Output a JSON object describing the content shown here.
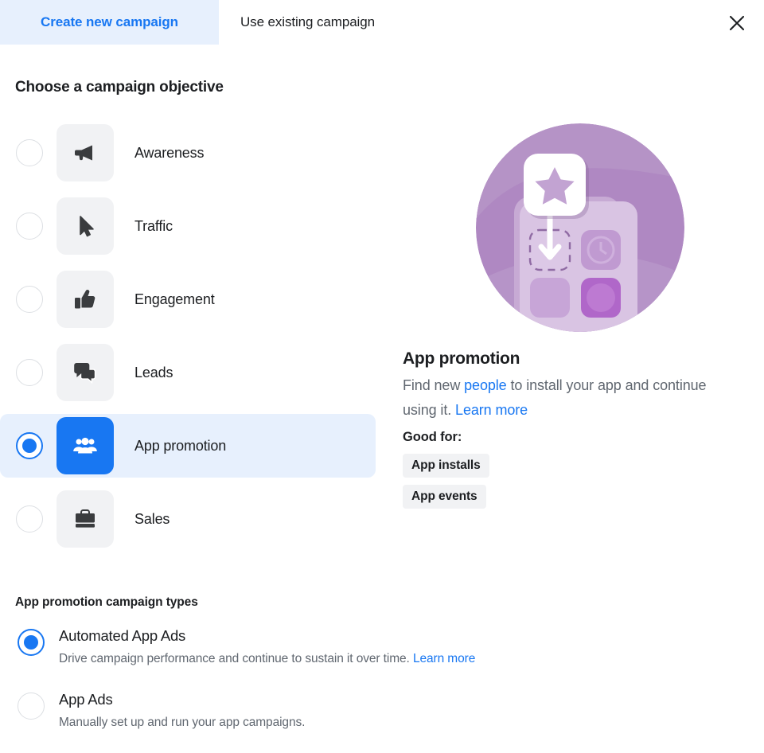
{
  "tabs": [
    {
      "label": "Create new campaign",
      "active": true
    },
    {
      "label": "Use existing campaign",
      "active": false
    }
  ],
  "close_icon": "close-icon",
  "headings": {
    "objective": "Choose a campaign objective",
    "campaign_types": "App promotion campaign types"
  },
  "objectives": [
    {
      "label": "Awareness",
      "icon": "megaphone-icon",
      "selected": false
    },
    {
      "label": "Traffic",
      "icon": "cursor-icon",
      "selected": false
    },
    {
      "label": "Engagement",
      "icon": "thumbs-up-icon",
      "selected": false
    },
    {
      "label": "Leads",
      "icon": "chat-bubbles-icon",
      "selected": false
    },
    {
      "label": "App promotion",
      "icon": "people-group-icon",
      "selected": true
    },
    {
      "label": "Sales",
      "icon": "briefcase-icon",
      "selected": false
    }
  ],
  "detail": {
    "illustration": "app-promotion-illustration",
    "title": "App promotion",
    "desc_part1": "Find new ",
    "desc_link1": "people",
    "desc_part2": " to install your app and continue using it. ",
    "desc_link2": "Learn more",
    "good_for_label": "Good for:",
    "tags": [
      "App installs",
      "App events"
    ]
  },
  "campaign_types": [
    {
      "title": "Automated App Ads",
      "desc": "Drive campaign performance and continue to sustain it over time. ",
      "link": "Learn more",
      "selected": true
    },
    {
      "title": "App Ads",
      "desc": "Manually set up and run your app campaigns.",
      "link": "",
      "selected": false
    }
  ],
  "colors": {
    "accent": "#1877f2",
    "accent_bg": "#e7f0fd",
    "tile_bg": "#f1f2f4",
    "text": "#1c1e21",
    "muted": "#606770",
    "illustration_purple": "#b593c6"
  }
}
